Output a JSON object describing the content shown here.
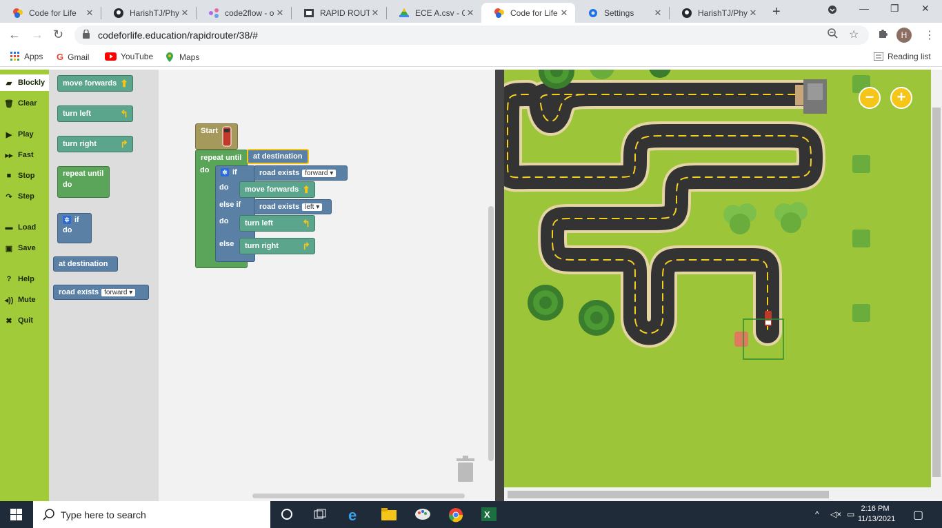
{
  "browser": {
    "tabs": [
      {
        "title": "Code for Life",
        "icon": "codeforlife-icon",
        "active": false
      },
      {
        "title": "HarishTJ/Phyt",
        "icon": "github-icon",
        "active": false
      },
      {
        "title": "code2flow - o",
        "icon": "code2flow-icon",
        "active": false
      },
      {
        "title": "RAPID ROUTE",
        "icon": "rapid-route-icon",
        "active": false
      },
      {
        "title": "ECE A.csv - G",
        "icon": "google-drive-icon",
        "active": false
      },
      {
        "title": "Code for Life",
        "icon": "codeforlife-icon",
        "active": true
      },
      {
        "title": "Settings",
        "icon": "settings-icon",
        "active": false
      },
      {
        "title": "HarishTJ/Phyt",
        "icon": "github-icon",
        "active": false
      }
    ],
    "url": "codeforlife.education/rapidrouter/38/#",
    "profile_initial": "H",
    "bookmarks": [
      "Apps",
      "Gmail",
      "YouTube",
      "Maps"
    ],
    "reading_list": "Reading list"
  },
  "sidebar": {
    "items": [
      {
        "label": "Blockly",
        "icon": "blockly-icon"
      },
      {
        "label": "Clear",
        "icon": "trash-icon"
      },
      {
        "label": "Play",
        "icon": "play-icon"
      },
      {
        "label": "Fast",
        "icon": "fast-forward-icon"
      },
      {
        "label": "Stop",
        "icon": "stop-icon"
      },
      {
        "label": "Step",
        "icon": "step-icon"
      },
      {
        "label": "Load",
        "icon": "folder-icon"
      },
      {
        "label": "Save",
        "icon": "save-icon"
      },
      {
        "label": "Help",
        "icon": "help-icon"
      },
      {
        "label": "Mute",
        "icon": "speaker-icon"
      },
      {
        "label": "Quit",
        "icon": "close-icon"
      }
    ]
  },
  "toolbox": {
    "move_forwards": "move forwards",
    "turn_left": "turn left",
    "turn_right": "turn right",
    "repeat_until": "repeat until",
    "do": "do",
    "if": "if",
    "at_destination": "at destination",
    "road_exists": "road exists",
    "forward": "forward"
  },
  "program": {
    "start": "Start",
    "repeat_until": "repeat until",
    "at_destination": "at destination",
    "do": "do",
    "if": "if",
    "road_exists": "road exists",
    "forward": "forward",
    "move_forwards": "move forwards",
    "else_if": "else if",
    "left": "left",
    "turn_left": "turn left",
    "else": "else",
    "turn_right": "turn right"
  },
  "map": {
    "zoom_out": "−",
    "zoom_in": "+",
    "grass_color": "#9cc53a",
    "road_color": "#333333"
  },
  "taskbar": {
    "search_placeholder": "Type here to search",
    "time": "2:16 PM",
    "date": "11/13/2021"
  }
}
